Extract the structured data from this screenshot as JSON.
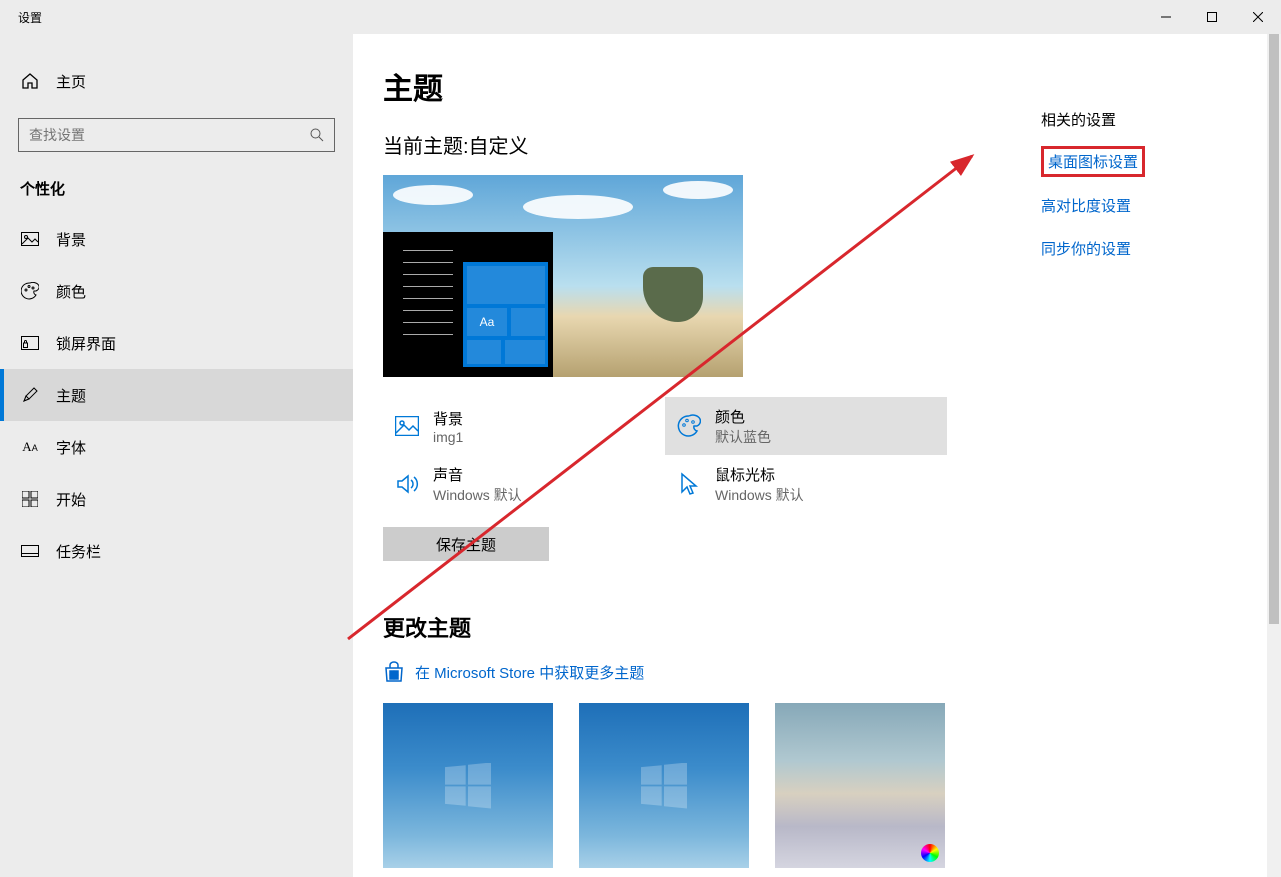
{
  "window": {
    "title": "设置"
  },
  "sidebar": {
    "home": "主页",
    "search_placeholder": "查找设置",
    "section": "个性化",
    "items": [
      {
        "label": "背景"
      },
      {
        "label": "颜色"
      },
      {
        "label": "锁屏界面"
      },
      {
        "label": "主题"
      },
      {
        "label": "字体"
      },
      {
        "label": "开始"
      },
      {
        "label": "任务栏"
      }
    ]
  },
  "main": {
    "title": "主题",
    "current_theme_label": "当前主题:自定义",
    "preview_tile_text": "Aa",
    "options": {
      "background": {
        "title": "背景",
        "value": "img1"
      },
      "color": {
        "title": "颜色",
        "value": "默认蓝色"
      },
      "sound": {
        "title": "声音",
        "value": "Windows 默认"
      },
      "cursor": {
        "title": "鼠标光标",
        "value": "Windows 默认"
      }
    },
    "save_button": "保存主题",
    "change_theme_heading": "更改主题",
    "store_link": "在 Microsoft Store 中获取更多主题"
  },
  "related": {
    "title": "相关的设置",
    "links": [
      "桌面图标设置",
      "高对比度设置",
      "同步你的设置"
    ]
  },
  "colors": {
    "accent": "#0078d7",
    "link": "#0066cc",
    "highlight_border": "#d8272d"
  }
}
